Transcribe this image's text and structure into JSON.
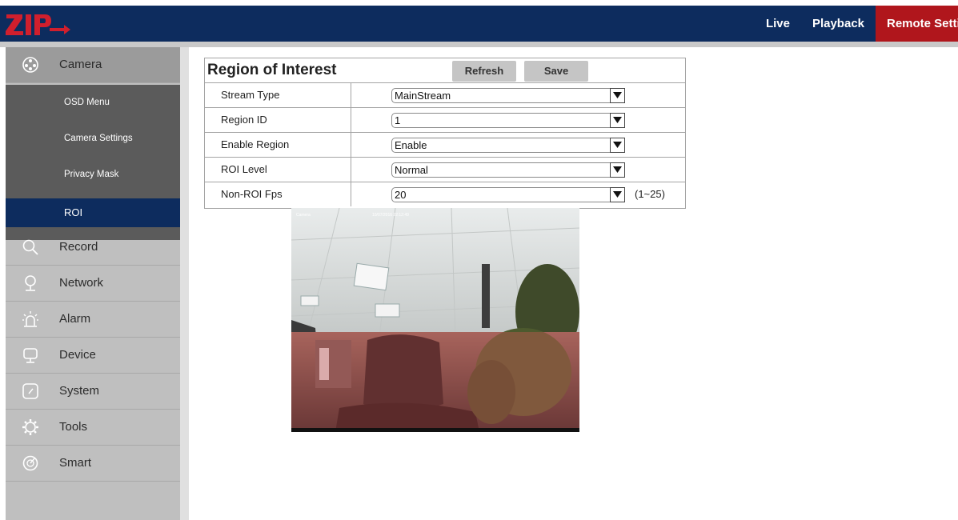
{
  "header": {
    "logo_text": "ZIP",
    "nav": [
      "Live",
      "Playback",
      "Remote Setting"
    ]
  },
  "sidebar": {
    "camera": {
      "label": "Camera",
      "icon": "camera-aperture-icon",
      "sub_items": [
        "OSD Menu",
        "Camera Settings",
        "Privacy Mask",
        "ROI"
      ],
      "active_sub": "ROI"
    },
    "items": [
      {
        "label": "Record",
        "icon": "search-icon"
      },
      {
        "label": "Network",
        "icon": "location-pin-icon"
      },
      {
        "label": "Alarm",
        "icon": "alarm-light-icon"
      },
      {
        "label": "Device",
        "icon": "monitor-icon"
      },
      {
        "label": "System",
        "icon": "gauge-icon"
      },
      {
        "label": "Tools",
        "icon": "gear-icon"
      },
      {
        "label": "Smart",
        "icon": "smart-dial-icon"
      }
    ]
  },
  "roi_panel": {
    "title": "Region of Interest",
    "refresh_label": "Refresh",
    "save_label": "Save",
    "rows": [
      {
        "label": "Stream Type",
        "value": "MainStream"
      },
      {
        "label": "Region ID",
        "value": "1"
      },
      {
        "label": "Enable Region",
        "value": "Enable"
      },
      {
        "label": "ROI Level",
        "value": "Normal"
      },
      {
        "label": "Non-ROI Fps",
        "value": "20",
        "range": "(1~25)"
      }
    ]
  },
  "preview": {
    "camera_name": "Camera",
    "timestamp": "10/07/2016 22:12:49"
  },
  "colors": {
    "header": "#0d2c5e",
    "active_nav": "#b0161c",
    "sidebar": "#bfbfbf",
    "submenu": "#5b5b5b",
    "active_sub": "#0d2c5e"
  }
}
